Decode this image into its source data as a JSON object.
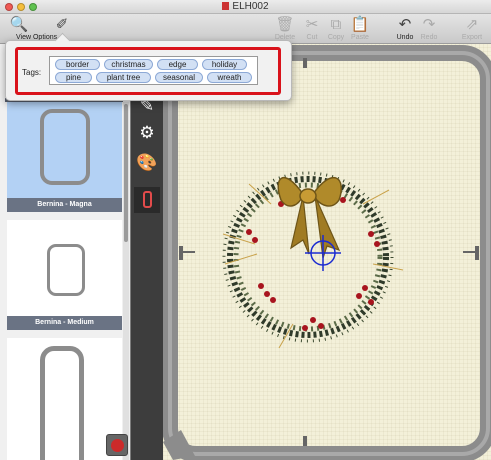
{
  "window": {
    "title": "ELH002"
  },
  "toolbar": {
    "view_options_label": "View Options",
    "items": [
      {
        "label": "Delete"
      },
      {
        "label": "Cut"
      },
      {
        "label": "Copy"
      },
      {
        "label": "Paste"
      },
      {
        "label": "Undo"
      },
      {
        "label": "Redo"
      },
      {
        "label": "Export"
      }
    ]
  },
  "tags_popover": {
    "label": "Tags:",
    "tags": [
      "border",
      "christmas",
      "edge",
      "holiday",
      "pine",
      "plant tree",
      "seasonal",
      "wreath"
    ]
  },
  "sidebar": {
    "thumbnails": [
      {
        "name": "Bernina - Magna",
        "selected": true
      },
      {
        "name": "Bernina - Medium",
        "selected": false
      },
      {
        "name": "",
        "selected": false
      }
    ]
  },
  "tool_strip": {
    "tools": [
      "stitch-tool-icon",
      "sewing-machine-icon",
      "palette-icon",
      "hoop-icon"
    ]
  },
  "colors": {
    "highlight_box": "#d9121b",
    "hoop_frame": "#8c8c8c",
    "canvas_fabric": "#f3f0d9",
    "crosshair": "#1b2bd1",
    "bow_gold": "#b08a2a",
    "berry_red": "#a8141e"
  }
}
